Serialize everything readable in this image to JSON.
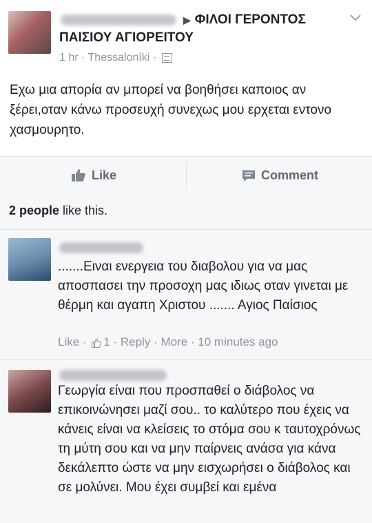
{
  "post": {
    "group": "ΦΙΛΟΙ ΓΕΡΟΝΤΟΣ ΠΑΙΣΙΟΥ ΑΓΙΟΡΕΙΤΟΥ",
    "time": "1 hr",
    "location": "Thessaloníki",
    "separator": "·",
    "body": "Εχω μια απορία αν μπορεί να βοηθήσει καποιος αν ξέρει,οταν κάνω προσευχή συνεχως μου ερχεται εντονο χασμουρητο."
  },
  "actions": {
    "like_label": "Like",
    "comment_label": "Comment"
  },
  "likes_summary": {
    "count": "2 people",
    "suffix": " like this."
  },
  "comments": [
    {
      "text": ".......Ειναι ενεργεια του διαβολου για να μας αποσπασει την προσοχη μας ιδιως οταν γινεται με θέρμη και αγαπη Χριστου ....... Αγιος Παίσιος",
      "like_label": "Like",
      "like_count": "1",
      "reply_label": "Reply",
      "more_label": "More",
      "time": "10 minutes ago"
    },
    {
      "text": "Γεωργία είναι που προσπαθεί ο διάβολος να επικοινώνησει μαζί σου.. το καλύτερο που έχεις να κάνεις είναι να κλείσεις το στόμα σου κ ταυτοχρόνως τη μύτη σου και να μην παίρνεις ανάσα για κάνα δεκάλεπτο ώστε να μην εισχωρήσει ο διάβολος και σε μολύνει. Μου έχει συμβεί και εμένα"
    }
  ],
  "colors": {
    "text": "#1d2129",
    "secondary": "#90949c",
    "action": "#606770",
    "background": "#e9ebee"
  },
  "icons": [
    "chevron-down-icon",
    "globe-icon",
    "thumbs-up-icon",
    "comment-bubble-icon",
    "small-like-icon"
  ]
}
